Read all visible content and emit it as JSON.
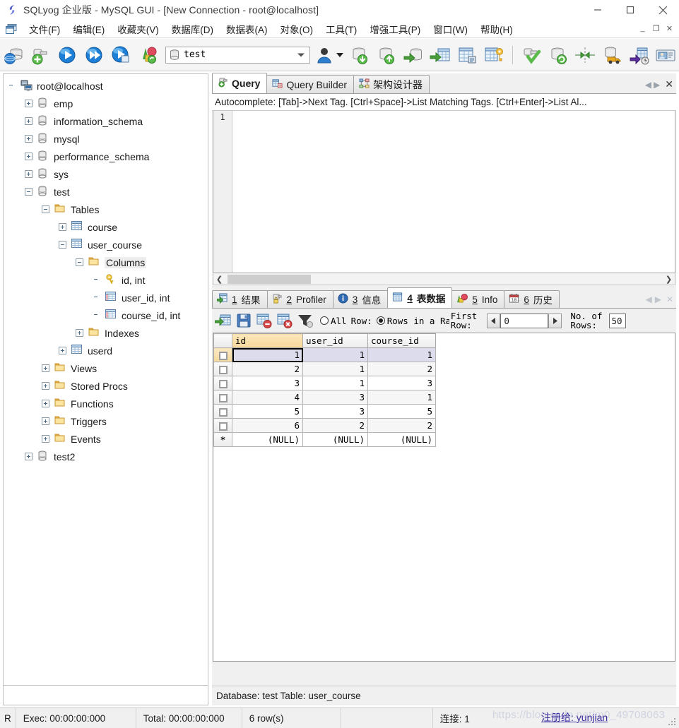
{
  "window": {
    "title": "SQLyog 企业版 - MySQL GUI - [New Connection - root@localhost]",
    "app_icon": "sqlyog-icon",
    "minimize": "minimize-icon",
    "maximize": "maximize-icon",
    "close": "close-icon"
  },
  "menubar": {
    "mdi_icon": "mdi-window-icon",
    "items": [
      {
        "label": "文件(F)",
        "name": "menu-file"
      },
      {
        "label": "编辑(E)",
        "name": "menu-edit"
      },
      {
        "label": "收藏夹(V)",
        "name": "menu-favorites"
      },
      {
        "label": "数据库(D)",
        "name": "menu-database"
      },
      {
        "label": "数据表(A)",
        "name": "menu-table"
      },
      {
        "label": "对象(O)",
        "name": "menu-object"
      },
      {
        "label": "工具(T)",
        "name": "menu-tools"
      },
      {
        "label": "增强工具(P)",
        "name": "menu-powertools"
      },
      {
        "label": "窗口(W)",
        "name": "menu-window"
      },
      {
        "label": "帮助(H)",
        "name": "menu-help"
      }
    ],
    "mdi_buttons": [
      "_",
      "❐",
      "✕"
    ]
  },
  "toolbar": {
    "database_selector": {
      "value": "test",
      "icon": "database-icon"
    },
    "buttons": [
      {
        "name": "new-connection-button",
        "icon": "connection-icon"
      },
      {
        "name": "save-connection-button",
        "icon": "save-connection-icon"
      },
      {
        "name": "execute-query-button",
        "icon": "play-icon"
      },
      {
        "name": "execute-all-queries-button",
        "icon": "play-all-icon"
      },
      {
        "name": "execute-query-new-tab-button",
        "icon": "play-newtab-icon"
      },
      {
        "name": "stop-query-button",
        "icon": "chart-icon"
      },
      {
        "name": "user-manager-button",
        "icon": "user-icon"
      },
      {
        "name": "import-database-button",
        "icon": "db-down-icon"
      },
      {
        "name": "export-database-button",
        "icon": "db-up-icon"
      },
      {
        "name": "backup-database-button",
        "icon": "db-arrow-icon"
      },
      {
        "name": "export-table-button",
        "icon": "table-export-icon"
      },
      {
        "name": "table-diagnostics-button",
        "icon": "table-info-icon"
      },
      {
        "name": "table-key-button",
        "icon": "table-key-icon"
      },
      {
        "name": "sql-formatter-button",
        "icon": "paint-check-icon"
      },
      {
        "name": "refresh-object-browser-button",
        "icon": "db-refresh-icon"
      },
      {
        "name": "data-sync-button",
        "icon": "sync-icon"
      },
      {
        "name": "migration-button",
        "icon": "truck-icon"
      },
      {
        "name": "scheduler-button",
        "icon": "scheduler-icon"
      },
      {
        "name": "notifications-button",
        "icon": "notification-icon"
      }
    ]
  },
  "tree": [
    {
      "label": "root@localhost",
      "icon": "server-icon",
      "indent": 0,
      "expander": "none",
      "selected": false
    },
    {
      "label": "emp",
      "icon": "database-icon",
      "indent": 1,
      "expander": "plus",
      "selected": false
    },
    {
      "label": "information_schema",
      "icon": "database-icon",
      "indent": 1,
      "expander": "plus",
      "selected": false
    },
    {
      "label": "mysql",
      "icon": "database-icon",
      "indent": 1,
      "expander": "plus",
      "selected": false
    },
    {
      "label": "performance_schema",
      "icon": "database-icon",
      "indent": 1,
      "expander": "plus",
      "selected": false
    },
    {
      "label": "sys",
      "icon": "database-icon",
      "indent": 1,
      "expander": "plus",
      "selected": false
    },
    {
      "label": "test",
      "icon": "database-icon",
      "indent": 1,
      "expander": "minus",
      "selected": false
    },
    {
      "label": "Tables",
      "icon": "folder-icon",
      "indent": 2,
      "expander": "minus",
      "selected": false
    },
    {
      "label": "course",
      "icon": "table-icon",
      "indent": 3,
      "expander": "plus",
      "selected": false
    },
    {
      "label": "user_course",
      "icon": "table-icon",
      "indent": 3,
      "expander": "minus",
      "selected": false
    },
    {
      "label": "Columns",
      "icon": "folder-icon",
      "indent": 4,
      "expander": "minus",
      "selected": true
    },
    {
      "label": "id, int",
      "icon": "key-icon",
      "indent": 5,
      "expander": "none",
      "selected": false
    },
    {
      "label": "user_id, int",
      "icon": "column-icon",
      "indent": 5,
      "expander": "none",
      "selected": false
    },
    {
      "label": "course_id, int",
      "icon": "column-icon",
      "indent": 5,
      "expander": "none",
      "selected": false
    },
    {
      "label": "Indexes",
      "icon": "folder-icon",
      "indent": 4,
      "expander": "plus",
      "selected": false
    },
    {
      "label": "userd",
      "icon": "table-icon",
      "indent": 3,
      "expander": "plus",
      "selected": false
    },
    {
      "label": "Views",
      "icon": "folder-icon",
      "indent": 2,
      "expander": "plus",
      "selected": false
    },
    {
      "label": "Stored Procs",
      "icon": "folder-icon",
      "indent": 2,
      "expander": "plus",
      "selected": false
    },
    {
      "label": "Functions",
      "icon": "folder-icon",
      "indent": 2,
      "expander": "plus",
      "selected": false
    },
    {
      "label": "Triggers",
      "icon": "folder-icon",
      "indent": 2,
      "expander": "plus",
      "selected": false
    },
    {
      "label": "Events",
      "icon": "folder-icon",
      "indent": 2,
      "expander": "plus",
      "selected": false
    },
    {
      "label": "test2",
      "icon": "database-icon",
      "indent": 1,
      "expander": "plus",
      "selected": false
    }
  ],
  "query_tabs": {
    "tabs": [
      {
        "label": "Query",
        "icon": "query-icon",
        "active": true,
        "name": "tab-query"
      },
      {
        "label": "Query Builder",
        "icon": "query-builder-icon",
        "active": false,
        "name": "tab-query-builder"
      },
      {
        "label": "架构设计器",
        "icon": "schema-designer-icon",
        "active": false,
        "name": "tab-schema-designer"
      }
    ],
    "nav": {
      "prev": "◀",
      "next": "▶",
      "close": "✕"
    }
  },
  "autocomplete_hint": "Autocomplete: [Tab]->Next Tag. [Ctrl+Space]->List Matching Tags. [Ctrl+Enter]->List Al...",
  "editor": {
    "line_number": "1",
    "content": ""
  },
  "result_tabs": {
    "tabs": [
      {
        "num": "1",
        "label": "结果",
        "icon": "result-icon",
        "active": false,
        "name": "tab-result"
      },
      {
        "num": "2",
        "label": "Profiler",
        "icon": "profiler-icon",
        "active": false,
        "name": "tab-profiler"
      },
      {
        "num": "3",
        "label": "信息",
        "icon": "info-icon",
        "active": false,
        "name": "tab-message"
      },
      {
        "num": "4",
        "label": "表数据",
        "icon": "table-data-icon",
        "active": true,
        "name": "tab-table-data"
      },
      {
        "num": "5",
        "label": "Info",
        "icon": "chart-icon",
        "active": false,
        "name": "tab-info"
      },
      {
        "num": "6",
        "label": "历史",
        "icon": "calendar-icon",
        "active": false,
        "name": "tab-history"
      }
    ],
    "nav": {
      "prev": "◀",
      "next": "▶",
      "close": "✕"
    }
  },
  "grid_toolbar": {
    "buttons": [
      {
        "name": "refresh-data-button",
        "icon": "refresh-grid-icon"
      },
      {
        "name": "save-changes-button",
        "icon": "floppy-icon"
      },
      {
        "name": "delete-row-button",
        "icon": "delete-row-icon"
      },
      {
        "name": "discard-changes-button",
        "icon": "discard-icon"
      },
      {
        "name": "filter-button",
        "icon": "filter-icon"
      }
    ],
    "all_label": "All",
    "row_label": "Row:",
    "rows_in_range_label": "Rows in a Range",
    "first_row_label_1": "First",
    "first_row_label_2": "Row:",
    "first_row_value": "0",
    "no_of_rows_label_1": "No. of",
    "no_of_rows_label_2": "Rows:",
    "no_of_rows_value": "50",
    "prev_arrow": "◀",
    "next_arrow": "▶",
    "all_selected": false,
    "range_selected": true
  },
  "chart_data": {
    "type": "table",
    "title": "user_course",
    "columns": [
      "id",
      "user_id",
      "course_id"
    ],
    "rows": [
      [
        "1",
        "1",
        "1"
      ],
      [
        "2",
        "1",
        "2"
      ],
      [
        "3",
        "1",
        "3"
      ],
      [
        "4",
        "3",
        "1"
      ],
      [
        "5",
        "3",
        "5"
      ],
      [
        "6",
        "2",
        "2"
      ],
      [
        "(NULL)",
        "(NULL)",
        "(NULL)"
      ]
    ],
    "new_row_marker": "*",
    "selected_row_index": 0,
    "focused_cell": {
      "row": 0,
      "col": 0
    },
    "current_column": "id"
  },
  "db_status": "Database: test Table: user_course",
  "statusbar": {
    "indicator": "R",
    "exec": "Exec: 00:00:00:000",
    "total": "Total: 00:00:00:000",
    "rows": "6 row(s)",
    "blank": "",
    "connection": "连接: 1"
  },
  "watermark": {
    "url": "https://blog.csdn.net/m0_49708063",
    "overlay": "注册给: yunjian"
  },
  "colors": {
    "accent_blue": "#2f6cb5",
    "folder_yellow": "#edb94e",
    "current_column_header": "#f6d79a",
    "selected_row": "#dcdcec",
    "window_bg": "#f0f0f0"
  }
}
